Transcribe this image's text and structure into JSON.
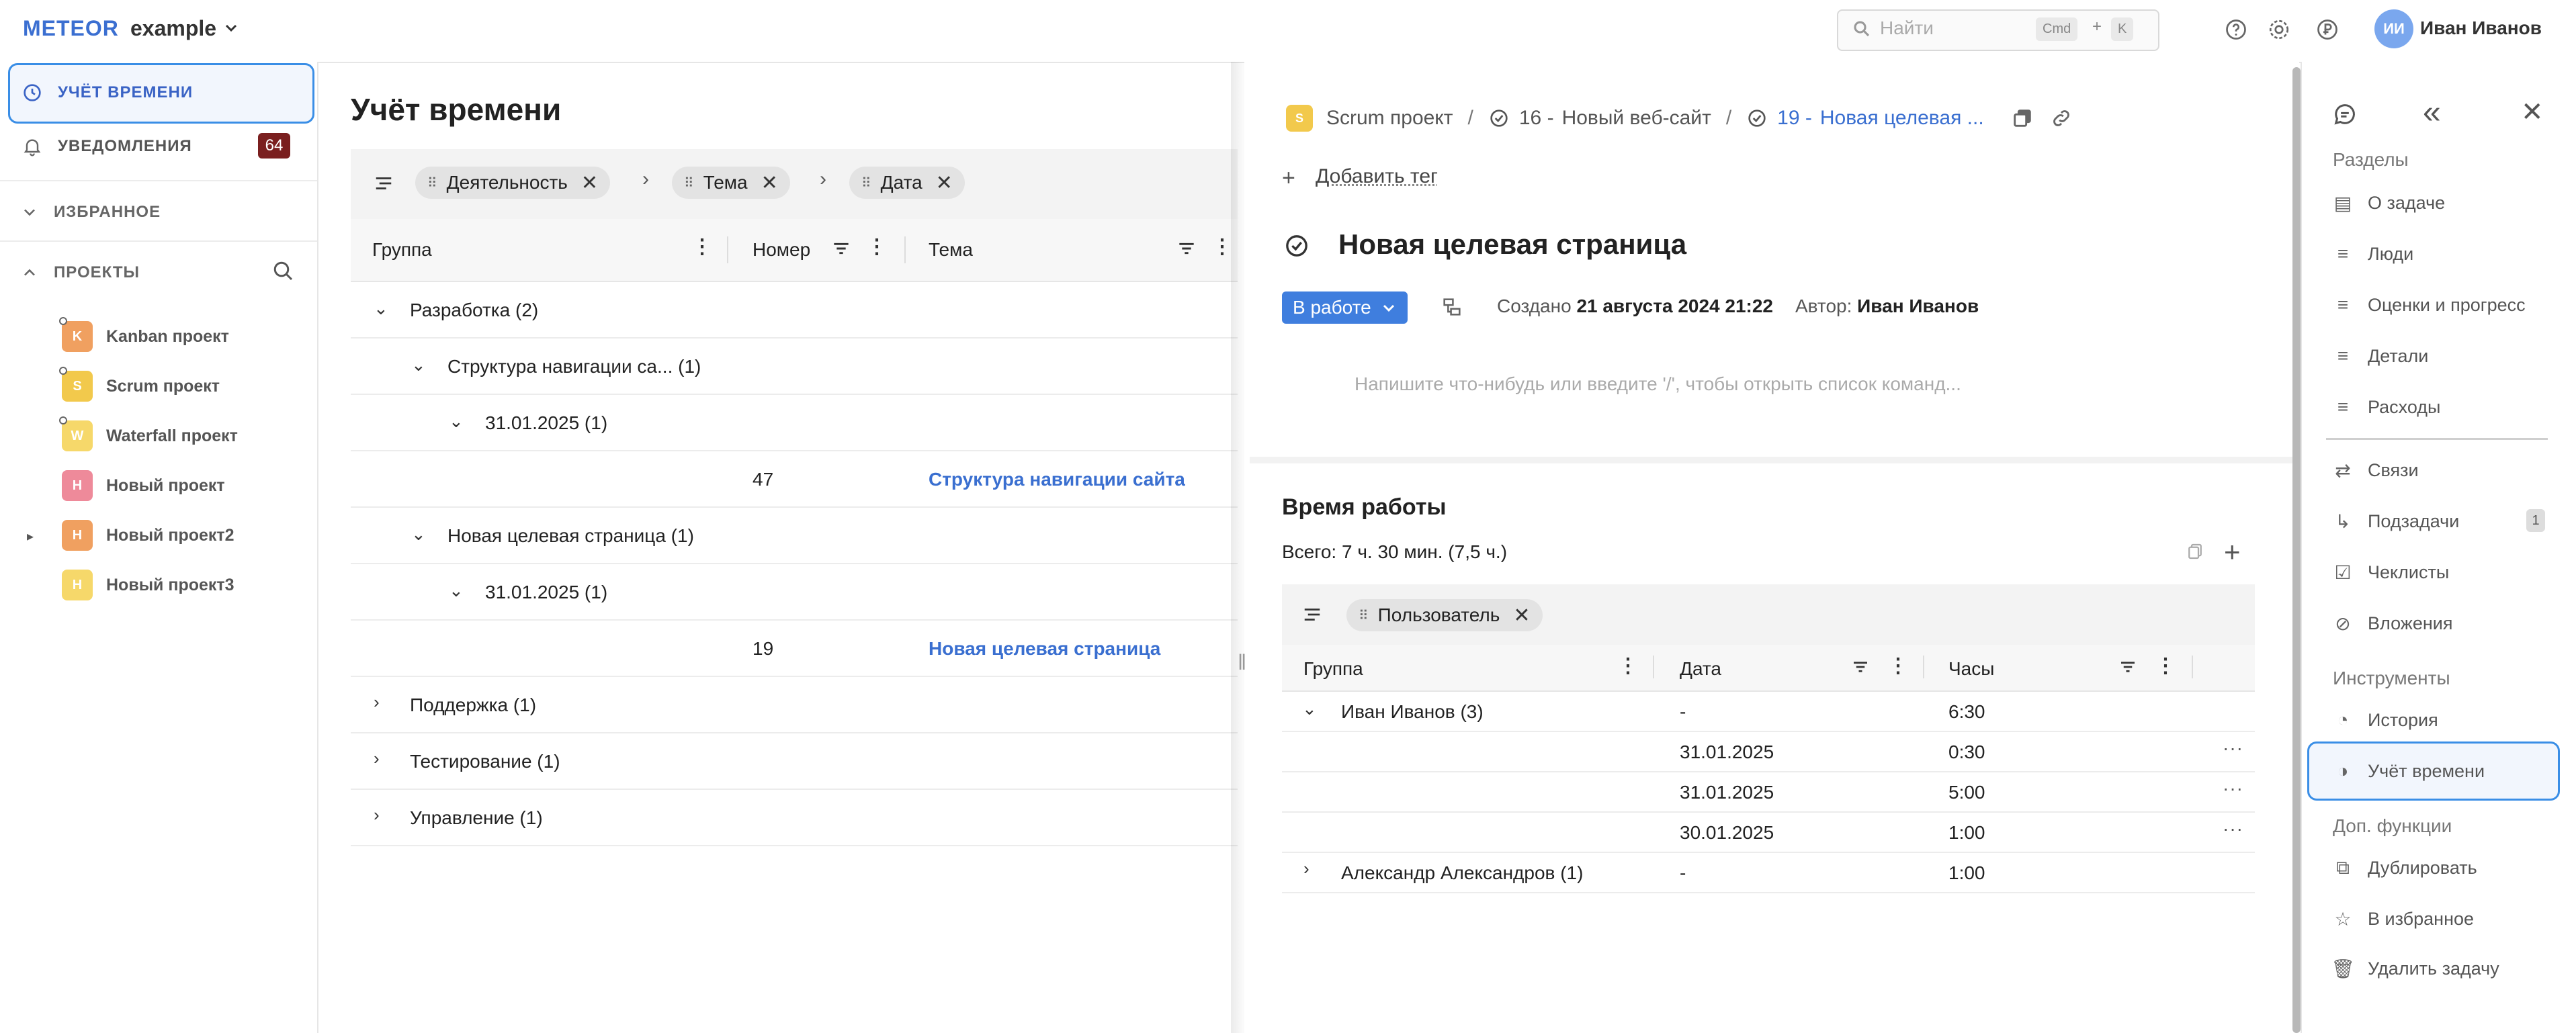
{
  "app": {
    "logo": "METEOR",
    "workspace": "example"
  },
  "topbar": {
    "search_placeholder": "Найти",
    "kbd_cmd": "Cmd",
    "kbd_plus": "+",
    "kbd_k": "K",
    "avatar_initials": "ИИ",
    "user_name": "Иван Иванов"
  },
  "sidebar": {
    "time_tracking": "УЧЁТ ВРЕМЕНИ",
    "notifications": "УВЕДОМЛЕНИЯ",
    "notifications_count": "64",
    "favorites": "ИЗБРАННОЕ",
    "projects": "ПРОЕКТЫ",
    "project_list": [
      {
        "badge": "K",
        "label": "Kanban проект",
        "color": "#f0a060"
      },
      {
        "badge": "S",
        "label": "Scrum проект",
        "color": "#f2c94c"
      },
      {
        "badge": "W",
        "label": "Waterfall проект",
        "color": "#f6d86a"
      },
      {
        "badge": "Н",
        "label": "Новый проект",
        "color": "#ee8a9a"
      },
      {
        "badge": "Н",
        "label": "Новый проект2",
        "color": "#f0a060"
      },
      {
        "badge": "Н",
        "label": "Новый проект3",
        "color": "#f6d86a"
      }
    ]
  },
  "main": {
    "title": "Учёт времени",
    "group_chips": [
      "Деятельность",
      "Тема",
      "Дата"
    ],
    "columns": [
      "Группа",
      "Номер",
      "Тема"
    ],
    "rows": [
      {
        "label": "Разработка (2)"
      },
      {
        "label": "Структура навигации са... (1)"
      },
      {
        "label": "31.01.2025 (1)"
      },
      {
        "number": "47",
        "topic": "Структура навигации сайта"
      },
      {
        "label": "Новая целевая страница (1)"
      },
      {
        "label": "31.01.2025 (1)"
      },
      {
        "number": "19",
        "topic": "Новая целевая страница"
      },
      {
        "label": "Поддержка (1)"
      },
      {
        "label": "Тестирование (1)"
      },
      {
        "label": "Управление (1)"
      }
    ]
  },
  "panel": {
    "breadcrumb": {
      "project_badge": "S",
      "project": "Scrum проект",
      "parent_number": "16 -",
      "parent": "Новый веб-сайт",
      "task_number": "19 -",
      "task": "Новая целевая ..."
    },
    "add_tag": "Добавить тег",
    "task_title": "Новая целевая страница",
    "status": "В работе",
    "created_label": "Создано",
    "created_value": "21 августа 2024 21:22",
    "author_label": "Автор:",
    "author_value": "Иван Иванов",
    "editor_placeholder": "Напишите что-нибудь или введите '/', чтобы открыть список команд...",
    "work": {
      "title": "Время работы",
      "total": "Всего: 7 ч. 30 мин. (7,5 ч.)",
      "group_chip": "Пользователь",
      "columns": [
        "Группа",
        "Дата",
        "Часы"
      ],
      "rows": [
        {
          "group": "Иван Иванов (3)",
          "date": "-",
          "hours": "6:30"
        },
        {
          "group": "",
          "date": "31.01.2025",
          "hours": "0:30"
        },
        {
          "group": "",
          "date": "31.01.2025",
          "hours": "5:00"
        },
        {
          "group": "",
          "date": "30.01.2025",
          "hours": "1:00"
        },
        {
          "group": "Александр Александров (1)",
          "date": "-",
          "hours": "1:00"
        }
      ]
    }
  },
  "rail": {
    "sections_heading": "Разделы",
    "sections": [
      "О задаче",
      "Люди",
      "Оценки и прогресс",
      "Детали",
      "Расходы"
    ],
    "links": [
      "Связи",
      "Подзадачи",
      "Чеклисты",
      "Вложения"
    ],
    "subtasks_count": "1",
    "tools_heading": "Инструменты",
    "tools": [
      "История",
      "Учёт времени"
    ],
    "extra_heading": "Доп. функции",
    "extra": [
      "Дублировать",
      "В избранное",
      "Удалить задачу"
    ]
  }
}
